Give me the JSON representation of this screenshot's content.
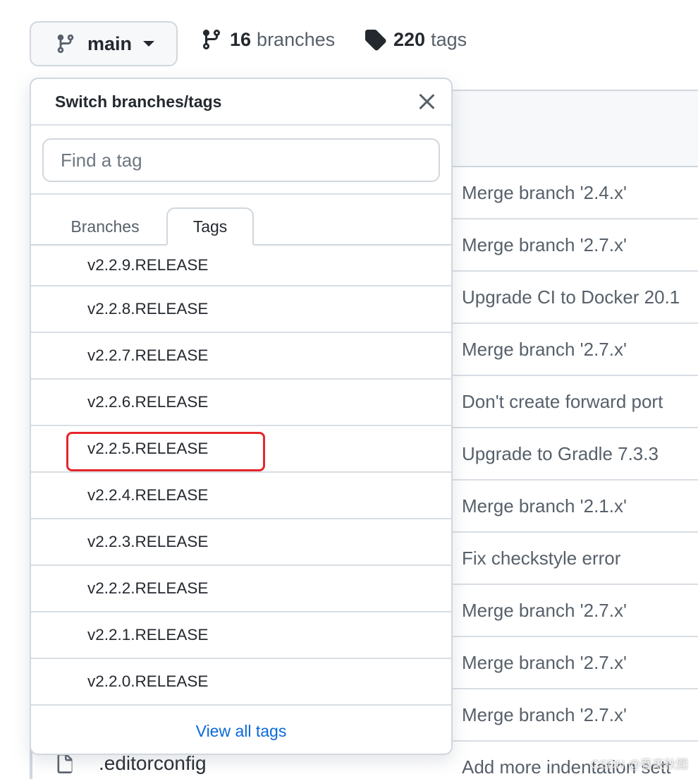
{
  "topbar": {
    "branch_label": "main",
    "branches_count": "16",
    "branches_label": "branches",
    "tags_count": "220",
    "tags_label": "tags"
  },
  "dropdown": {
    "title": "Switch branches/tags",
    "filter_placeholder": "Find a tag",
    "tabs": [
      {
        "label": "Branches",
        "active": false
      },
      {
        "label": "Tags",
        "active": true
      }
    ],
    "tags": [
      {
        "label": "v2.2.9.RELEASE"
      },
      {
        "label": "v2.2.8.RELEASE"
      },
      {
        "label": "v2.2.7.RELEASE"
      },
      {
        "label": "v2.2.6.RELEASE"
      },
      {
        "label": "v2.2.5.RELEASE",
        "highlighted": true
      },
      {
        "label": "v2.2.4.RELEASE"
      },
      {
        "label": "v2.2.3.RELEASE"
      },
      {
        "label": "v2.2.2.RELEASE"
      },
      {
        "label": "v2.2.1.RELEASE"
      },
      {
        "label": "v2.2.0.RELEASE"
      }
    ],
    "footer_link": "View all tags"
  },
  "commits": [
    "Merge branch '2.4.x'",
    "Merge branch '2.7.x'",
    "Upgrade CI to Docker 20.1",
    "Merge branch '2.7.x'",
    "Don't create forward port",
    "Upgrade to Gradle 7.3.3",
    "Merge branch '2.1.x'",
    "Fix checkstyle error",
    "Merge branch '2.7.x'",
    "Merge branch '2.7.x'",
    "Merge branch '2.7.x'",
    "Add more indentation sett"
  ],
  "file_row": {
    "name": ".editorconfig",
    "icon": "file-icon"
  },
  "watermark": "CSDN @春来秋图",
  "colors": {
    "accent_link": "#0969da",
    "highlight_border": "#e5262a",
    "border": "#d0d7de"
  }
}
